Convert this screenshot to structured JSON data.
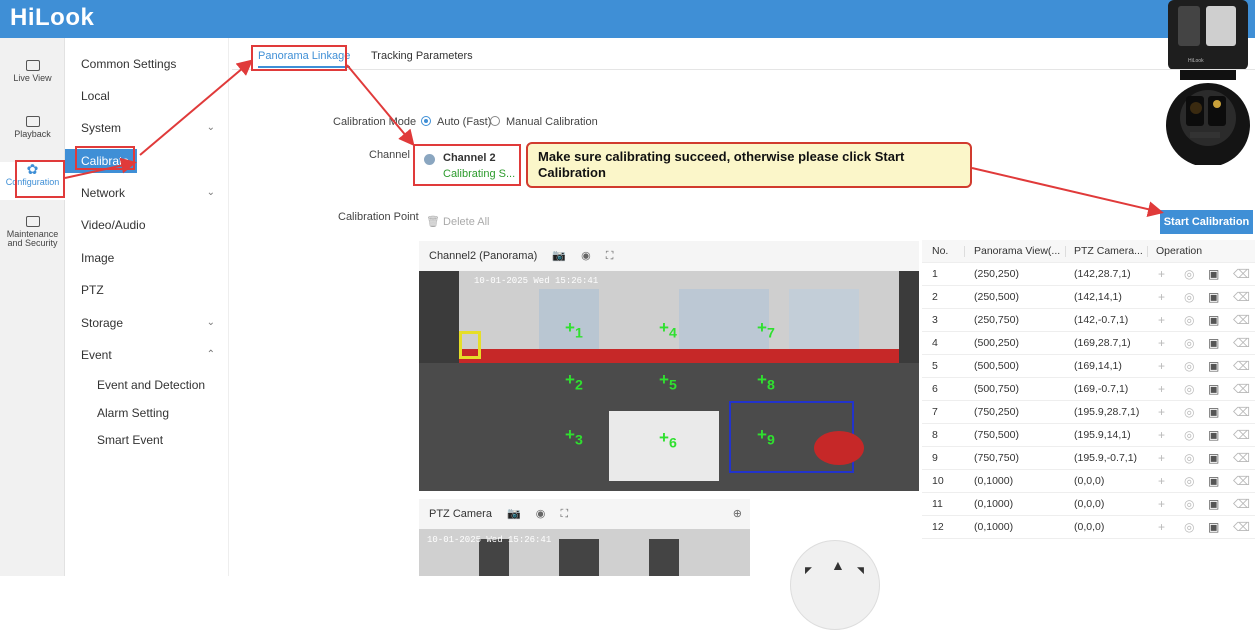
{
  "brand": {
    "logo": "HiLook",
    "header_color": "#3f8fd6",
    "accent": "#3f8fd6",
    "annotation_color": "#e03a3a"
  },
  "rail": [
    {
      "label": "Live View",
      "icon": "monitor-icon"
    },
    {
      "label": "Playback",
      "icon": "play-icon"
    },
    {
      "label": "Configuration",
      "icon": "gear-icon"
    },
    {
      "label_line1": "Maintenance",
      "label_line2": "and Security",
      "icon": "wrench-icon"
    }
  ],
  "menu": {
    "common": "Common Settings",
    "local": "Local",
    "system": "System",
    "calibrate": "Calibrate",
    "network": "Network",
    "video_audio": "Video/Audio",
    "image": "Image",
    "ptz": "PTZ",
    "storage": "Storage",
    "event": "Event",
    "event_detection": "Event and Detection",
    "alarm_setting": "Alarm Setting",
    "smart_event": "Smart Event"
  },
  "tabs": {
    "panorama": "Panorama Linkage",
    "tracking": "Tracking Parameters"
  },
  "form": {
    "calibration_mode_label": "Calibration Mode",
    "mode_auto": "Auto (Fast)",
    "mode_manual": "Manual Calibration",
    "channel_label": "Channel",
    "channel_name": "Channel 2",
    "channel_status": "Calibrating S...",
    "calibration_point_label": "Calibration Point",
    "delete_all": "Delete All",
    "start_calibration": "Start Calibration"
  },
  "callout": {
    "text": "Make sure calibrating succeed, otherwise please click Start Calibration"
  },
  "panorama_panel": {
    "title": "Channel2 (Panorama)",
    "timestamp": "10-01-2025 Wed 15:26:41"
  },
  "ptz_panel": {
    "title": "PTZ Camera",
    "timestamp": "10-01-2025 Wed 15:26:41"
  },
  "table": {
    "headers": [
      "No.",
      "Panorama View(...",
      "PTZ Camera...",
      "Operation"
    ],
    "rows": [
      [
        "1",
        "(250,250)",
        "(142,28.7,1)"
      ],
      [
        "2",
        "(250,500)",
        "(142,14,1)"
      ],
      [
        "3",
        "(250,750)",
        "(142,-0.7,1)"
      ],
      [
        "4",
        "(500,250)",
        "(169,28.7,1)"
      ],
      [
        "5",
        "(500,500)",
        "(169,14,1)"
      ],
      [
        "6",
        "(500,750)",
        "(169,-0.7,1)"
      ],
      [
        "7",
        "(750,250)",
        "(195.9,28.7,1)"
      ],
      [
        "8",
        "(750,500)",
        "(195.9,14,1)"
      ],
      [
        "9",
        "(750,750)",
        "(195.9,-0.7,1)"
      ],
      [
        "10",
        "(0,1000)",
        "(0,0,0)"
      ],
      [
        "11",
        "(0,1000)",
        "(0,0,0)"
      ],
      [
        "12",
        "(0,1000)",
        "(0,0,0)"
      ]
    ]
  },
  "marker_labels": [
    "1",
    "2",
    "3",
    "4",
    "5",
    "6",
    "7",
    "8",
    "9"
  ],
  "camera_label": "HiLook"
}
